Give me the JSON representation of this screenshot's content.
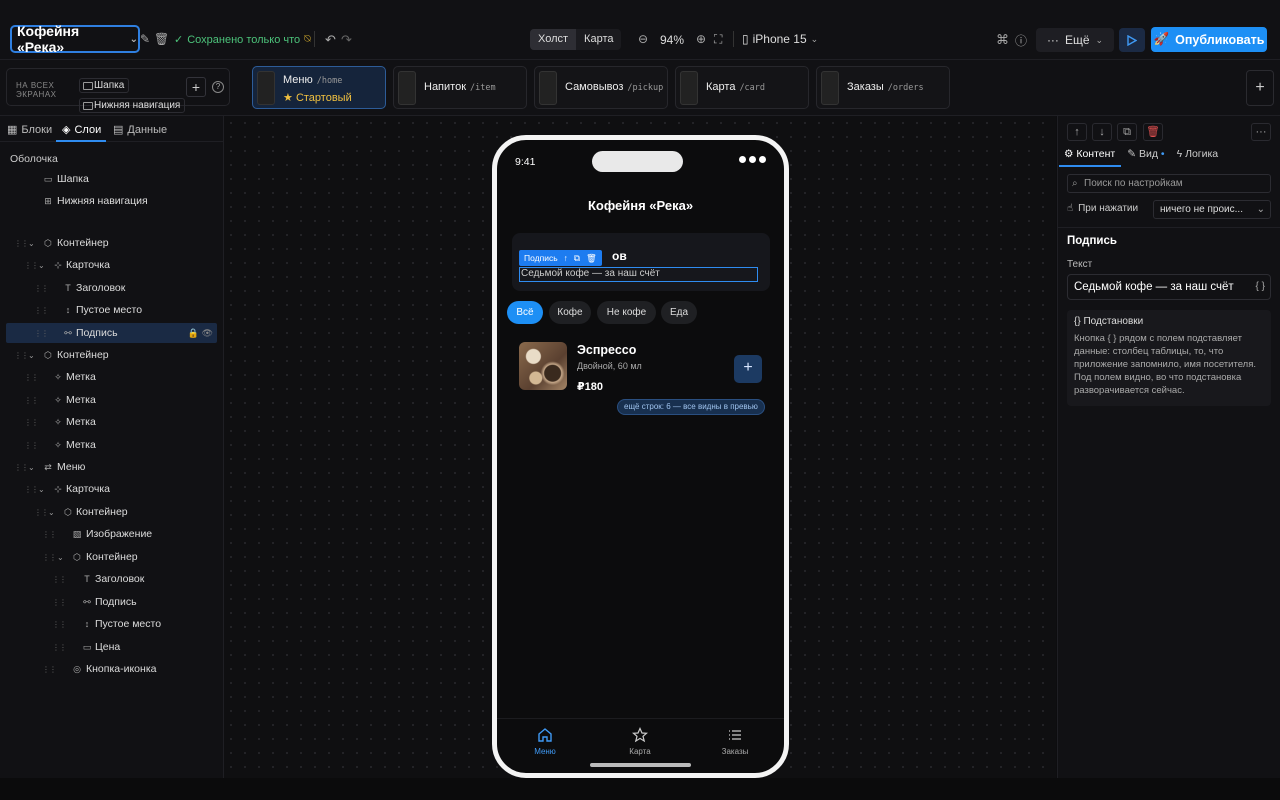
{
  "header": {
    "project_name": "Кофейня «Река»",
    "save_status": "Сохранено только что",
    "view_modes": [
      "Холст",
      "Карта"
    ],
    "zoom": "94%",
    "device": "iPhone 15",
    "more_label": "Ещё",
    "publish_label": "Опубликовать"
  },
  "strip": {
    "all_screens_label": "НА ВСЕХ ЭКРАНАХ",
    "global_blocks": [
      "Шапка",
      "Нижняя навигация"
    ],
    "screens": [
      {
        "name": "Меню",
        "route": "/home",
        "badge": "Стартовый"
      },
      {
        "name": "Напиток",
        "route": "/item"
      },
      {
        "name": "Самовывоз",
        "route": "/pickup"
      },
      {
        "name": "Карта",
        "route": "/card"
      },
      {
        "name": "Заказы",
        "route": "/orders"
      }
    ]
  },
  "left_panel": {
    "tabs": [
      "Блоки",
      "Слои",
      "Данные"
    ],
    "shell_label": "Оболочка",
    "shell_items": [
      "Шапка",
      "Нижняя навигация"
    ],
    "layers": [
      "Контейнер",
      "Карточка",
      "Заголовок",
      "Пустое место",
      "Подпись",
      "Контейнер",
      "Метка",
      "Метка",
      "Метка",
      "Метка",
      "Меню",
      "Карточка",
      "Контейнер",
      "Изображение",
      "Контейнер",
      "Заголовок",
      "Подпись",
      "Пустое место",
      "Цена",
      "Кнопка-иконка"
    ]
  },
  "phone": {
    "time": "9:41",
    "title": "Кофейня «Река»",
    "banner_title_tail": "ов",
    "selection_label": "Подпись",
    "banner_subtitle": "Седьмой кофе — за наш счёт",
    "filters": [
      "Всё",
      "Кофе",
      "Не кофе",
      "Еда"
    ],
    "product": {
      "name": "Эспрессо",
      "desc": "Двойной, 60 мл",
      "price": "₽180"
    },
    "more_rows": "ещё строк: 6 — все видны в превью",
    "tabbar": [
      "Меню",
      "Карта",
      "Заказы"
    ]
  },
  "right_panel": {
    "tabs": [
      "Контент",
      "Вид",
      "Логика"
    ],
    "search_placeholder": "Поиск по настройкам",
    "on_click_label": "При нажатии",
    "on_click_value": "ничего не проис...",
    "section_title": "Подпись",
    "text_label": "Текст",
    "text_value": "Седьмой кофе — за наш счёт",
    "hint_title": "Подстановки",
    "hint_body": "Кнопка { } рядом с полем подставляет данные: столбец таблицы, то, что приложение запомнило, имя посетителя. Под полем видно, во что подстановка разворачивается сейчас."
  },
  "colors": {
    "accent": "#1d8ff5",
    "saved": "#4cc27a",
    "star": "#f0c040"
  }
}
